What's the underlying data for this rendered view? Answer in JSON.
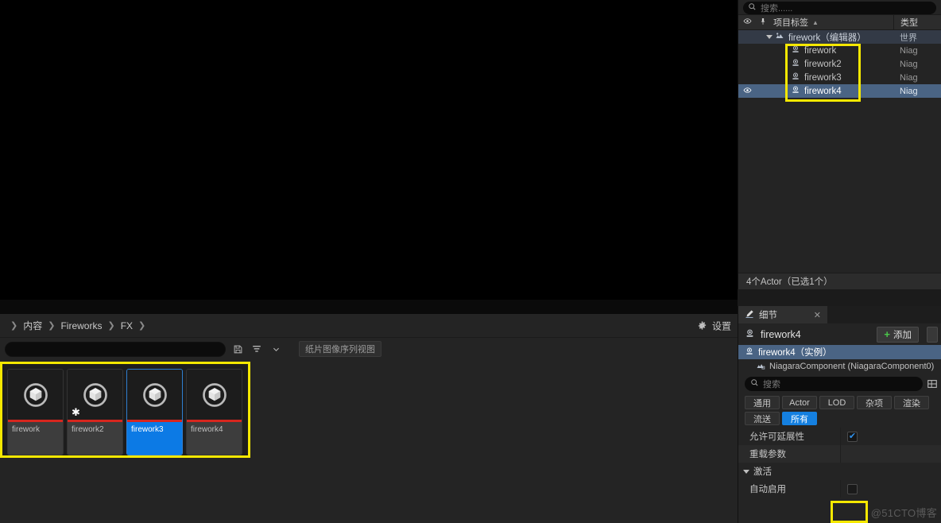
{
  "viewport": {
    "name": "level-viewport"
  },
  "content_browser": {
    "breadcrumb": [
      "内容",
      "Fireworks",
      "FX"
    ],
    "settings_label": "设置",
    "search_placeholder": "",
    "search_value": "",
    "save_icon": "save-icon",
    "filter_icon": "filter-icon",
    "view_mode_label": "纸片图像序列视图",
    "assets": [
      {
        "name": "firework",
        "selected": false,
        "dirty": false,
        "type_color": "#d7261e"
      },
      {
        "name": "firework2",
        "selected": false,
        "dirty": true,
        "type_color": "#d7261e"
      },
      {
        "name": "firework3",
        "selected": true,
        "dirty": false,
        "type_color": "#d7261e"
      },
      {
        "name": "firework4",
        "selected": false,
        "dirty": false,
        "type_color": "#d7261e"
      }
    ]
  },
  "outliner": {
    "search_placeholder": "搜索......",
    "search_value": "",
    "header": {
      "eye_icon": "eye-icon",
      "pin_icon": "pin-icon",
      "label": "项目标签",
      "sort_arrow": "▲",
      "type_column": "类型"
    },
    "rows": [
      {
        "name": "firework（编辑器）",
        "type": "世界",
        "indent": 1,
        "kind": "world",
        "expanded": true,
        "selected": false,
        "eye": false
      },
      {
        "name": "firework",
        "type": "Niag",
        "indent": 2,
        "kind": "actor",
        "expanded": false,
        "selected": false,
        "eye": false
      },
      {
        "name": "firework2",
        "type": "Niag",
        "indent": 2,
        "kind": "actor",
        "expanded": false,
        "selected": false,
        "eye": false
      },
      {
        "name": "firework3",
        "type": "Niag",
        "indent": 2,
        "kind": "actor",
        "expanded": false,
        "selected": false,
        "eye": false
      },
      {
        "name": "firework4",
        "type": "Niag",
        "indent": 2,
        "kind": "actor",
        "expanded": false,
        "selected": true,
        "eye": true
      }
    ],
    "status": "4个Actor（已选1个）"
  },
  "details": {
    "tab_label": "细节",
    "tab_icon": "pencil-icon",
    "tab_close": "✕",
    "title": "firework4",
    "add_label": "添加",
    "components": [
      {
        "label": "firework4（实例）",
        "selected": true,
        "child": false
      },
      {
        "label": "NiagaraComponent (NiagaraComponent0)",
        "selected": false,
        "child": true
      }
    ],
    "search_placeholder": "搜索",
    "search_value": "",
    "filters": [
      {
        "label": "通用",
        "active": false
      },
      {
        "label": "Actor",
        "active": false
      },
      {
        "label": "LOD",
        "active": false
      },
      {
        "label": "杂项",
        "active": false
      },
      {
        "label": "渲染",
        "active": false
      },
      {
        "label": "流送",
        "active": false
      },
      {
        "label": "所有",
        "active": true
      }
    ],
    "properties": [
      {
        "name": "允许可延展性",
        "kind": "checkbox",
        "checked": true,
        "alt": false
      },
      {
        "name": "重载参数",
        "kind": "label",
        "checked": false,
        "alt": true
      }
    ],
    "section": {
      "label": "激活",
      "expanded": true
    },
    "section_properties": [
      {
        "name": "自动启用",
        "kind": "checkbox",
        "checked": false,
        "alt": false
      }
    ]
  },
  "annotations": {
    "highlight_color": "#f5e800",
    "outliner_box": "actor-list-highlight",
    "asset_box": "asset-grid-highlight",
    "autoactivate_box": "auto-activate-highlight"
  },
  "watermark": "@51CTO博客"
}
